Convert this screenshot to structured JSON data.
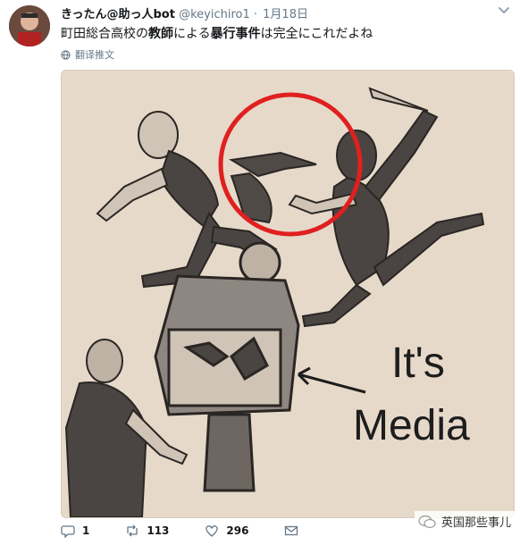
{
  "tweet": {
    "display_name": "きったん@助っ人bot",
    "handle": "@keyichiro1",
    "separator": "·",
    "date": "1月18日",
    "text_part1": "町田総合高校の",
    "text_bold1": "教師",
    "text_part2": "による",
    "text_bold2": "暴行事件",
    "text_part3": "は完全にこれだよね",
    "translate_label": "翻译推文"
  },
  "image": {
    "caption_line1": "It's",
    "caption_line2": "Media"
  },
  "actions": {
    "reply_count": "1",
    "retweet_count": "113",
    "like_count": "296"
  },
  "watermark": {
    "text": "英国那些事儿"
  },
  "colors": {
    "accent_red": "#e02020",
    "text_secondary": "#657786",
    "paper": "#e9dccd"
  }
}
